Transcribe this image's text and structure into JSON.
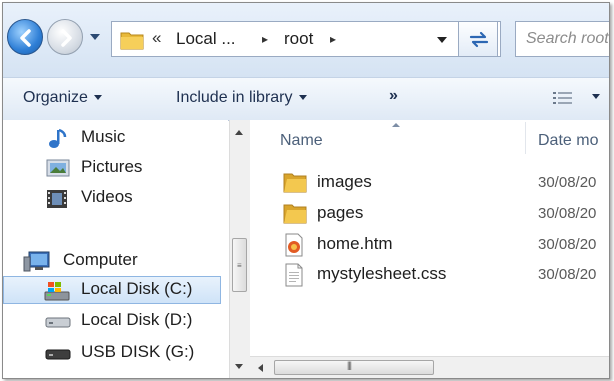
{
  "address_bar": {
    "chevron": "«",
    "crumbs": [
      "Local ...",
      "root"
    ],
    "separator": "▸",
    "search_placeholder": "Search root"
  },
  "command_bar": {
    "organize": "Organize",
    "include_in_library": "Include in library",
    "more": "»"
  },
  "nav_pane": {
    "items": [
      {
        "label": "Music",
        "icon": "music-icon"
      },
      {
        "label": "Pictures",
        "icon": "pictures-icon"
      },
      {
        "label": "Videos",
        "icon": "videos-icon"
      },
      {
        "label": "Computer",
        "icon": "computer-icon"
      },
      {
        "label": "Local Disk (C:)",
        "icon": "system-drive-icon",
        "selected": true
      },
      {
        "label": "Local Disk (D:)",
        "icon": "drive-icon"
      },
      {
        "label": "USB DISK (G:)",
        "icon": "usb-drive-icon"
      }
    ]
  },
  "file_list": {
    "columns": [
      "Name",
      "Date mo"
    ],
    "rows": [
      {
        "name": "images",
        "date": "30/08/20",
        "icon": "folder-icon"
      },
      {
        "name": "pages",
        "date": "30/08/20",
        "icon": "folder-icon"
      },
      {
        "name": "home.htm",
        "date": "30/08/20",
        "icon": "html-file-icon"
      },
      {
        "name": "mystylesheet.css",
        "date": "30/08/20",
        "icon": "css-file-icon"
      }
    ]
  },
  "colors": {
    "selection_fill": "#cfe3f8",
    "selection_border": "#8fb6e2",
    "toolbar_bg": "#dfe9f5",
    "folder": "#e8b93a"
  }
}
